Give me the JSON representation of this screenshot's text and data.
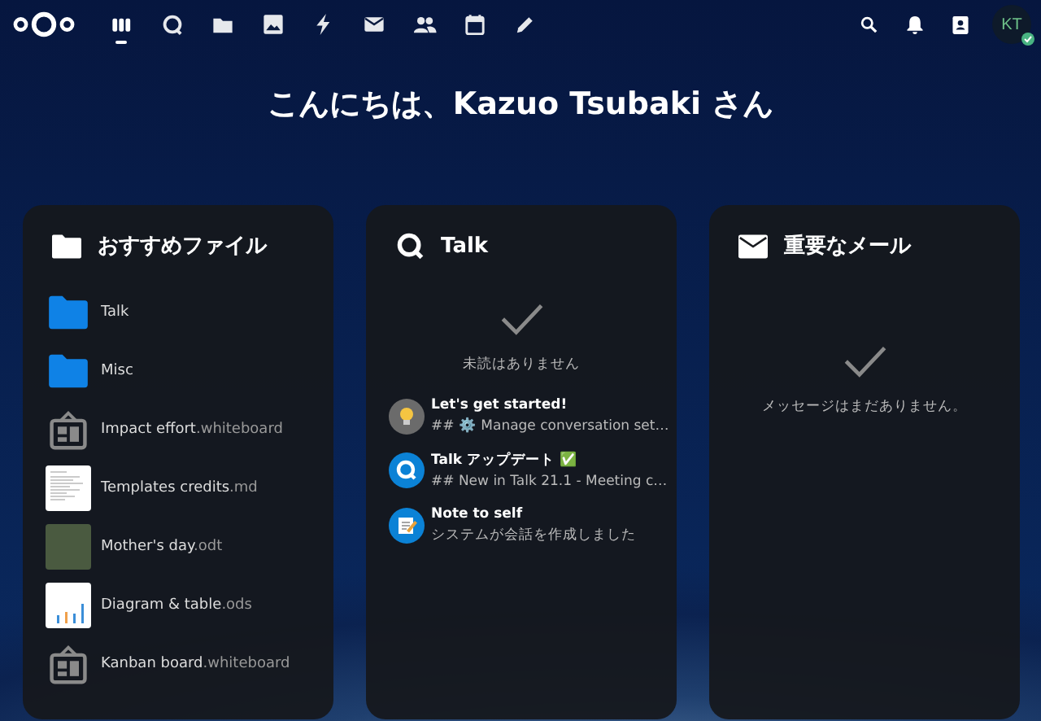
{
  "header": {
    "apps": [
      {
        "kind": "dashboard",
        "selected": true
      },
      {
        "kind": "talk",
        "selected": false
      },
      {
        "kind": "files",
        "selected": false
      },
      {
        "kind": "photos",
        "selected": false
      },
      {
        "kind": "activity",
        "selected": false
      },
      {
        "kind": "mail",
        "selected": false
      },
      {
        "kind": "contacts",
        "selected": false
      },
      {
        "kind": "calendar",
        "selected": false
      },
      {
        "kind": "notes",
        "selected": false
      }
    ],
    "actions": [
      {
        "kind": "search"
      },
      {
        "kind": "notifications"
      },
      {
        "kind": "contacts-menu"
      }
    ],
    "avatar": {
      "initials": "KT",
      "online": true
    }
  },
  "greeting": "こんにちは、Kazuo Tsubaki さん",
  "widgets": [
    {
      "kind": "files",
      "title": "おすすめファイル",
      "items": [
        {
          "kind": "folder",
          "name": "Talk"
        },
        {
          "kind": "folder",
          "name": "Misc"
        },
        {
          "kind": "whiteboard",
          "name": "Impact effort",
          "ext": ".whiteboard"
        },
        {
          "kind": "document",
          "name": "Templates credits",
          "ext": ".md"
        },
        {
          "kind": "photo",
          "name": "Mother's day",
          "ext": ".odt"
        },
        {
          "kind": "spreadsheet",
          "name": "Diagram & table",
          "ext": ".ods"
        },
        {
          "kind": "whiteboard",
          "name": "Kanban board",
          "ext": ".whiteboard"
        }
      ]
    },
    {
      "kind": "talk",
      "title": "Talk",
      "empty_text": "未読はありません",
      "items": [
        {
          "kind": "bulb",
          "title": "Let's get started!",
          "subtitle": "## ⚙️ Manage conversation set…"
        },
        {
          "kind": "talk",
          "title": "Talk アップデート ✅",
          "subtitle": "## New in Talk 21.1 - Meeting c…"
        },
        {
          "kind": "note",
          "title": "Note to self",
          "subtitle": "システムが会話を作成しました"
        }
      ]
    },
    {
      "kind": "mail",
      "title": "重要なメール",
      "empty_text": "メッセージはまだありません。"
    }
  ]
}
